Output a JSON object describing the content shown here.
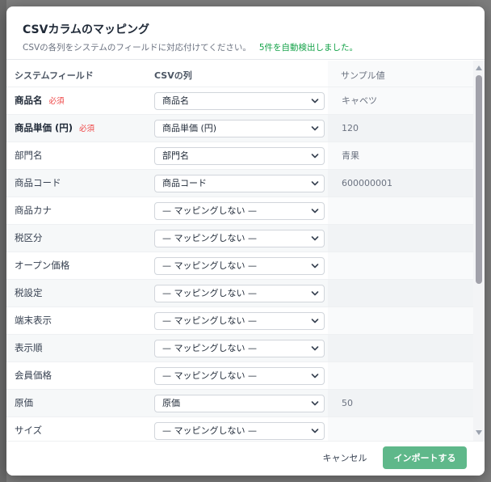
{
  "dialog": {
    "title": "CSVカラムのマッピング",
    "description": "CSVの各列をシステムのフィールドに対応付けてください。",
    "auto_detect": "5件を自動検出しました。"
  },
  "table": {
    "headers": {
      "field": "システムフィールド",
      "column": "CSVの列",
      "sample": "サンプル値"
    },
    "required_badge": "必須",
    "rows": [
      {
        "field": "商品名",
        "required": true,
        "selected": "商品名",
        "sample": "キャベツ"
      },
      {
        "field": "商品単価 (円)",
        "required": true,
        "selected": "商品単価 (円)",
        "sample": "120"
      },
      {
        "field": "部門名",
        "required": false,
        "selected": "部門名",
        "sample": "青果"
      },
      {
        "field": "商品コード",
        "required": false,
        "selected": "商品コード",
        "sample": "600000001"
      },
      {
        "field": "商品カナ",
        "required": false,
        "selected": "— マッピングしない —",
        "sample": ""
      },
      {
        "field": "税区分",
        "required": false,
        "selected": "— マッピングしない —",
        "sample": ""
      },
      {
        "field": "オープン価格",
        "required": false,
        "selected": "— マッピングしない —",
        "sample": ""
      },
      {
        "field": "税設定",
        "required": false,
        "selected": "— マッピングしない —",
        "sample": ""
      },
      {
        "field": "端末表示",
        "required": false,
        "selected": "— マッピングしない —",
        "sample": ""
      },
      {
        "field": "表示順",
        "required": false,
        "selected": "— マッピングしない —",
        "sample": ""
      },
      {
        "field": "会員価格",
        "required": false,
        "selected": "— マッピングしない —",
        "sample": ""
      },
      {
        "field": "原価",
        "required": false,
        "selected": "原価",
        "sample": "50"
      },
      {
        "field": "サイズ",
        "required": false,
        "selected": "— マッピングしない —",
        "sample": ""
      }
    ]
  },
  "footer": {
    "cancel_label": "キャンセル",
    "import_label": "インポートする"
  },
  "colors": {
    "accent": "#5fb88a",
    "required": "#ef4444",
    "auto_detect": "#16a34a"
  }
}
